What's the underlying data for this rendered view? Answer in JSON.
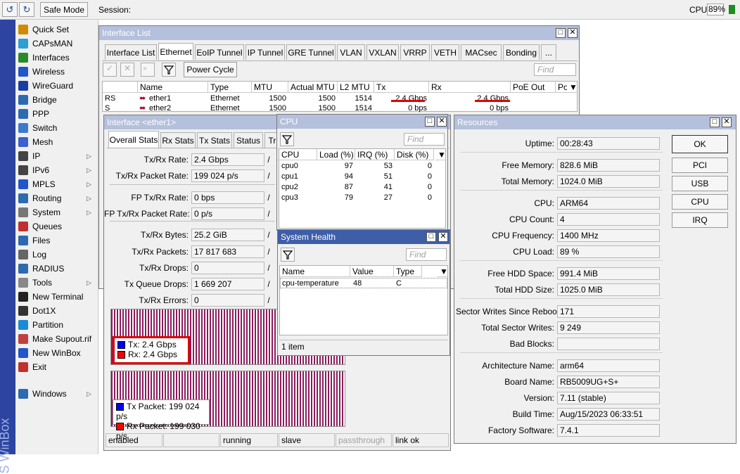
{
  "toolbar": {
    "safe_mode": "Safe Mode",
    "session_label": "Session:",
    "cpu_label": "CPU:",
    "cpu_value": "89%"
  },
  "sidebar": {
    "brand": "S WinBox",
    "items": [
      {
        "label": "Quick Set",
        "icon": "wand-icon",
        "arrow": false
      },
      {
        "label": "CAPsMAN",
        "icon": "capsman-icon",
        "arrow": false
      },
      {
        "label": "Interfaces",
        "icon": "interfaces-icon",
        "arrow": false
      },
      {
        "label": "Wireless",
        "icon": "wireless-icon",
        "arrow": false
      },
      {
        "label": "WireGuard",
        "icon": "wireguard-icon",
        "arrow": false
      },
      {
        "label": "Bridge",
        "icon": "bridge-icon",
        "arrow": false
      },
      {
        "label": "PPP",
        "icon": "ppp-icon",
        "arrow": false
      },
      {
        "label": "Switch",
        "icon": "switch-icon",
        "arrow": false
      },
      {
        "label": "Mesh",
        "icon": "mesh-icon",
        "arrow": false
      },
      {
        "label": "IP",
        "icon": "ip-icon",
        "arrow": true
      },
      {
        "label": "IPv6",
        "icon": "ipv6-icon",
        "arrow": true
      },
      {
        "label": "MPLS",
        "icon": "mpls-icon",
        "arrow": true
      },
      {
        "label": "Routing",
        "icon": "routing-icon",
        "arrow": true
      },
      {
        "label": "System",
        "icon": "gear-icon",
        "arrow": true
      },
      {
        "label": "Queues",
        "icon": "queues-icon",
        "arrow": false
      },
      {
        "label": "Files",
        "icon": "folder-icon",
        "arrow": false
      },
      {
        "label": "Log",
        "icon": "log-icon",
        "arrow": false
      },
      {
        "label": "RADIUS",
        "icon": "radius-icon",
        "arrow": false
      },
      {
        "label": "Tools",
        "icon": "tools-icon",
        "arrow": true
      },
      {
        "label": "New Terminal",
        "icon": "terminal-icon",
        "arrow": false
      },
      {
        "label": "Dot1X",
        "icon": "dot1x-icon",
        "arrow": false
      },
      {
        "label": "Partition",
        "icon": "partition-icon",
        "arrow": false
      },
      {
        "label": "Make Supout.rif",
        "icon": "supout-icon",
        "arrow": false
      },
      {
        "label": "New WinBox",
        "icon": "winbox-icon",
        "arrow": false
      },
      {
        "label": "Exit",
        "icon": "exit-icon",
        "arrow": false
      },
      {
        "label": "Windows",
        "icon": "windows-icon",
        "arrow": true
      }
    ]
  },
  "interface_list": {
    "title": "Interface List",
    "tabs": [
      "Interface List",
      "Ethernet",
      "EoIP Tunnel",
      "IP Tunnel",
      "GRE Tunnel",
      "VLAN",
      "VXLAN",
      "VRRP",
      "VETH",
      "MACsec",
      "Bonding",
      "..."
    ],
    "selected_tab": "Ethernet",
    "power_cycle": "Power Cycle",
    "find_placeholder": "Find",
    "columns": [
      "",
      "Name",
      "Type",
      "MTU",
      "Actual MTU",
      "L2 MTU",
      "Tx",
      "Rx",
      "PoE Out",
      "Po"
    ],
    "rows": [
      {
        "flags": "RS",
        "name": "ether1",
        "type": "Ethernet",
        "mtu": "1500",
        "actual_mtu": "1500",
        "l2mtu": "1514",
        "tx": "2.4 Gbps",
        "rx": "2.4 Gbps"
      },
      {
        "flags": "S",
        "name": "ether2",
        "type": "Ethernet",
        "mtu": "1500",
        "actual_mtu": "1500",
        "l2mtu": "1514",
        "tx": "0 bps",
        "rx": "0 bps"
      }
    ]
  },
  "iface_ether1": {
    "title": "Interface <ether1>",
    "tabs": [
      "Overall Stats",
      "Rx Stats",
      "Tx Stats",
      "Status",
      "Tr"
    ],
    "fields": [
      {
        "label": "Tx/Rx Rate:",
        "value": "2.4 Gbps"
      },
      {
        "label": "Tx/Rx Packet Rate:",
        "value": "199 024 p/s"
      },
      {
        "label": "FP Tx/Rx Rate:",
        "value": "0 bps"
      },
      {
        "label": "FP Tx/Rx Packet Rate:",
        "value": "0 p/s"
      },
      {
        "label": "Tx/Rx Bytes:",
        "value": "25.2 GiB"
      },
      {
        "label": "Tx/Rx Packets:",
        "value": "17 817 683"
      },
      {
        "label": "Tx/Rx Drops:",
        "value": "0"
      },
      {
        "label": "Tx Queue Drops:",
        "value": "1 669 207"
      },
      {
        "label": "Tx/Rx Errors:",
        "value": "0"
      }
    ],
    "separator": "/",
    "legend1": {
      "tx": "Tx:  2.4 Gbps",
      "rx": "Rx:  2.4 Gbps"
    },
    "legend2": {
      "tx": "Tx Packet:  199 024 p/s",
      "rx": "Rx Packet:  199 030 p/s"
    },
    "colors": {
      "tx": "#0000ff",
      "rx": "#ff0000",
      "graph": "#8a1c5c"
    },
    "status": [
      "enabled",
      "",
      "running",
      "slave",
      "passthrough",
      "link ok"
    ]
  },
  "cpu": {
    "title": "CPU",
    "find_placeholder": "Find",
    "columns": [
      "CPU",
      "Load (%)",
      "IRQ (%)",
      "Disk (%)"
    ],
    "rows": [
      {
        "cpu": "cpu0",
        "load": "97",
        "irq": "53",
        "disk": "0"
      },
      {
        "cpu": "cpu1",
        "load": "94",
        "irq": "51",
        "disk": "0"
      },
      {
        "cpu": "cpu2",
        "load": "87",
        "irq": "41",
        "disk": "0"
      },
      {
        "cpu": "cpu3",
        "load": "79",
        "irq": "27",
        "disk": "0"
      }
    ]
  },
  "health": {
    "title": "System Health",
    "find_placeholder": "Find",
    "columns": [
      "Name",
      "Value",
      "Type"
    ],
    "rows": [
      {
        "name": "cpu-temperature",
        "value": "48",
        "type": "C"
      }
    ],
    "count": "1 item"
  },
  "resources": {
    "title": "Resources",
    "buttons": [
      "OK",
      "PCI",
      "USB",
      "CPU",
      "IRQ"
    ],
    "fields": [
      {
        "label": "Uptime:",
        "value": "00:28:43"
      },
      {
        "label": "Free Memory:",
        "value": "828.6 MiB"
      },
      {
        "label": "Total Memory:",
        "value": "1024.0 MiB"
      },
      {
        "label": "CPU:",
        "value": "ARM64"
      },
      {
        "label": "CPU Count:",
        "value": "4"
      },
      {
        "label": "CPU Frequency:",
        "value": "1400 MHz"
      },
      {
        "label": "CPU Load:",
        "value": "89 %"
      },
      {
        "label": "Free HDD Space:",
        "value": "991.4 MiB"
      },
      {
        "label": "Total HDD Size:",
        "value": "1025.0 MiB"
      },
      {
        "label": "Sector Writes Since Reboot:",
        "value": "171"
      },
      {
        "label": "Total Sector Writes:",
        "value": "9 249"
      },
      {
        "label": "Bad Blocks:",
        "value": ""
      },
      {
        "label": "Architecture Name:",
        "value": "arm64"
      },
      {
        "label": "Board Name:",
        "value": "RB5009UG+S+"
      },
      {
        "label": "Version:",
        "value": "7.11 (stable)"
      },
      {
        "label": "Build Time:",
        "value": "Aug/15/2023 06:33:51"
      },
      {
        "label": "Factory Software:",
        "value": "7.4.1"
      }
    ]
  }
}
